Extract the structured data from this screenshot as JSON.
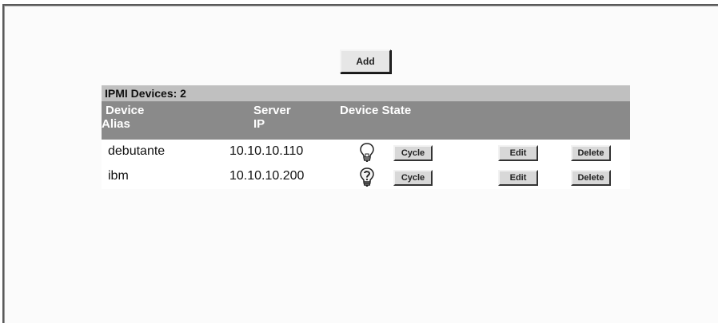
{
  "toolbar": {
    "add_label": "Add"
  },
  "table": {
    "count_label": "IPMI Devices: 2",
    "headers": {
      "alias_line1": "Device",
      "alias_line2": "Alias",
      "ip_line1": "Server",
      "ip_line2": "IP",
      "state": "Device State"
    },
    "rows": [
      {
        "alias": "debutante",
        "ip": "10.10.10.110",
        "state_icon": "lightbulb-off-icon",
        "cycle_label": "Cycle",
        "edit_label": "Edit",
        "delete_label": "Delete"
      },
      {
        "alias": "ibm",
        "ip": "10.10.10.200",
        "state_icon": "lightbulb-unknown-icon",
        "cycle_label": "Cycle",
        "edit_label": "Edit",
        "delete_label": "Delete"
      }
    ]
  },
  "colors": {
    "count_bar": "#c0c0c0",
    "header_bar": "#8a8a8a",
    "header_text": "#ffffff"
  }
}
